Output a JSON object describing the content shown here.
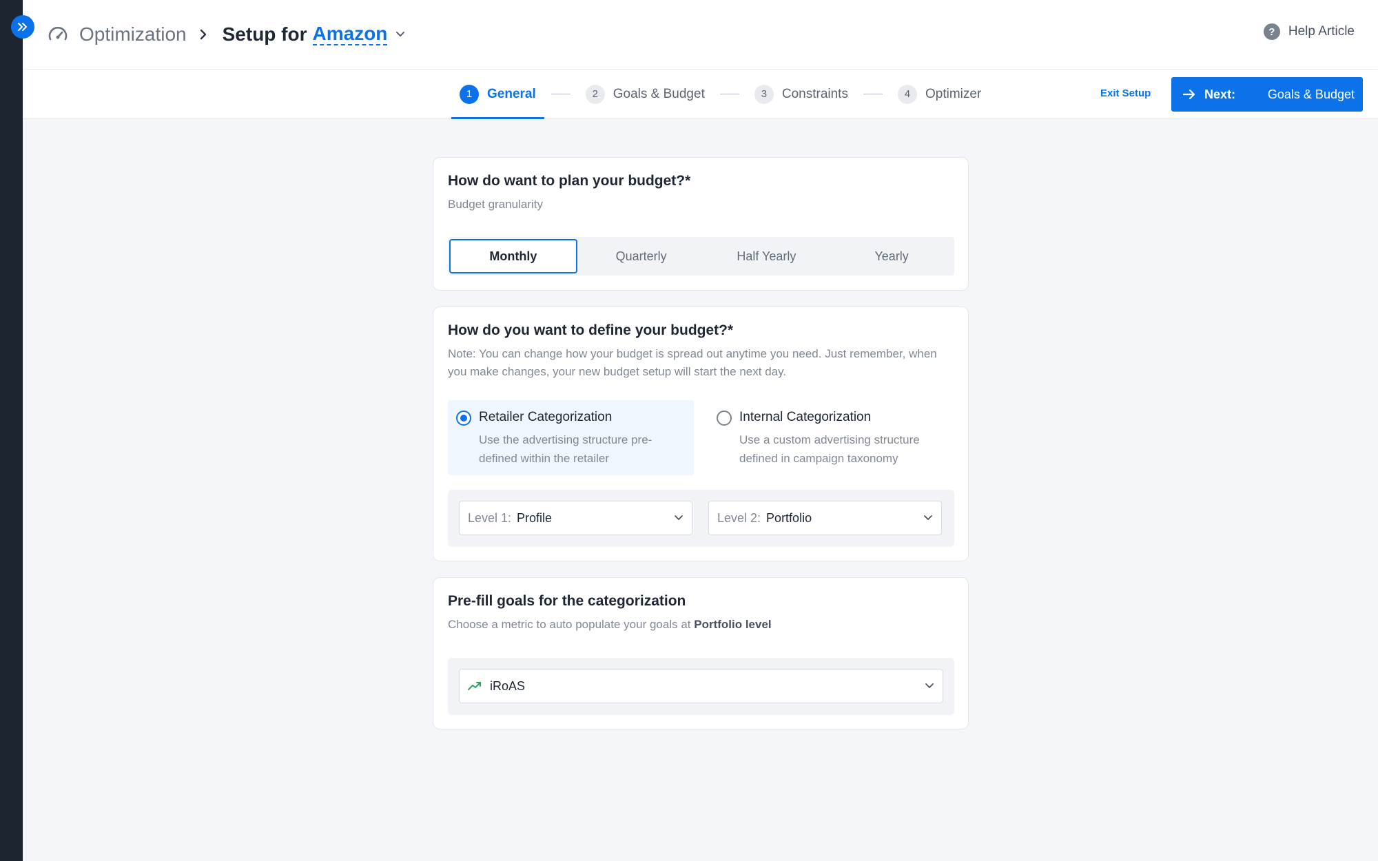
{
  "header": {
    "section": "Optimization",
    "setup_prefix": "Setup for",
    "retailer": "Amazon",
    "help_label": "Help Article"
  },
  "stepper": {
    "steps": [
      {
        "num": "1",
        "label": "General"
      },
      {
        "num": "2",
        "label": "Goals & Budget"
      },
      {
        "num": "3",
        "label": "Constraints"
      },
      {
        "num": "4",
        "label": "Optimizer"
      }
    ],
    "active_step": 1,
    "exit_label": "Exit Setup",
    "next_label": "Next:",
    "next_target": "Goals & Budget"
  },
  "plan": {
    "title": "How do want to plan your budget?*",
    "subtitle": "Budget granularity",
    "options": [
      "Monthly",
      "Quarterly",
      "Half Yearly",
      "Yearly"
    ],
    "selected": "Monthly"
  },
  "define": {
    "title": "How do you want to define your budget?*",
    "note": "Note: You can change how your budget is spread out anytime you need. Just remember, when you make changes, your new budget setup will start the next day.",
    "retailer": {
      "title": "Retailer Categorization",
      "desc": "Use the advertising structure pre-defined within the retailer",
      "selected": true
    },
    "internal": {
      "title": "Internal Categorization",
      "desc": "Use a custom advertising structure defined in campaign taxonomy",
      "selected": false
    },
    "level1": {
      "key": "Level 1:",
      "value": "Profile"
    },
    "level2": {
      "key": "Level 2:",
      "value": "Portfolio"
    }
  },
  "prefill": {
    "title": "Pre-fill goals for the categorization",
    "subtitle_prefix": "Choose a metric to auto populate your goals at",
    "subtitle_strong": "Portfolio level",
    "metric": "iRoAS"
  },
  "colors": {
    "accent": "#0b72ea",
    "sidebar": "#1c2530",
    "trend": "#2e9e5b"
  },
  "icons": [
    "expand-icon",
    "dashboard-icon",
    "chevron-right-icon",
    "chevron-down-icon",
    "help-icon",
    "arrow-right-icon",
    "trend-up-icon"
  ]
}
